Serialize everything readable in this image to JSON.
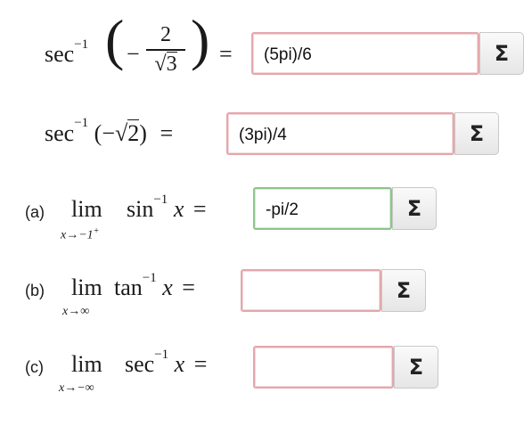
{
  "rows": [
    {
      "func": "sec",
      "exp": "−1",
      "equals": "=",
      "frac_num": "2",
      "frac_den": "3",
      "answer": "(5pi)/6",
      "sigma": "Σ"
    },
    {
      "func": "sec",
      "exp": "−1",
      "equals": "=",
      "arg": "2",
      "answer": "(3pi)/4",
      "sigma": "Σ"
    },
    {
      "label": "(a)",
      "lim": "lim",
      "sub": "x→−1",
      "sub_sup": "+",
      "func": "sin",
      "exp": "−1",
      "var": "x",
      "equals": "=",
      "answer": "-pi/2",
      "sigma": "Σ"
    },
    {
      "label": "(b)",
      "lim": "lim",
      "sub": "x→∞",
      "func": "tan",
      "exp": "−1",
      "var": "x",
      "equals": "=",
      "answer": "",
      "sigma": "Σ"
    },
    {
      "label": "(c)",
      "lim": "lim",
      "sub": "x→−∞",
      "func": "sec",
      "exp": "−1",
      "var": "x",
      "equals": "=",
      "answer": "",
      "sigma": "Σ"
    }
  ]
}
